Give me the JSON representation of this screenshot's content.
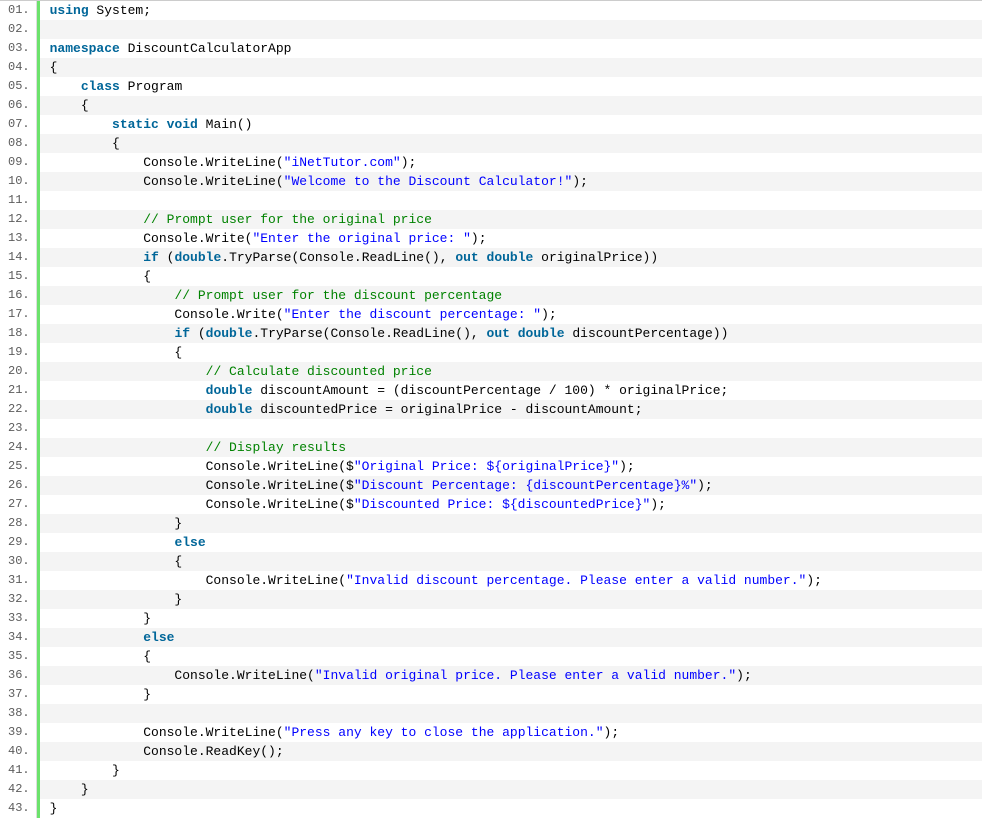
{
  "code": {
    "lines": [
      {
        "n": "01.",
        "tokens": [
          {
            "t": "kw",
            "v": "using"
          },
          {
            "t": "plain",
            "v": " System;"
          }
        ]
      },
      {
        "n": "02.",
        "tokens": []
      },
      {
        "n": "03.",
        "tokens": [
          {
            "t": "kw",
            "v": "namespace"
          },
          {
            "t": "plain",
            "v": " DiscountCalculatorApp"
          }
        ]
      },
      {
        "n": "04.",
        "tokens": [
          {
            "t": "plain",
            "v": "{"
          }
        ]
      },
      {
        "n": "05.",
        "tokens": [
          {
            "t": "plain",
            "v": "    "
          },
          {
            "t": "kw",
            "v": "class"
          },
          {
            "t": "plain",
            "v": " Program"
          }
        ]
      },
      {
        "n": "06.",
        "tokens": [
          {
            "t": "plain",
            "v": "    {"
          }
        ]
      },
      {
        "n": "07.",
        "tokens": [
          {
            "t": "plain",
            "v": "        "
          },
          {
            "t": "kw",
            "v": "static"
          },
          {
            "t": "plain",
            "v": " "
          },
          {
            "t": "kw",
            "v": "void"
          },
          {
            "t": "plain",
            "v": " Main()"
          }
        ]
      },
      {
        "n": "08.",
        "tokens": [
          {
            "t": "plain",
            "v": "        {"
          }
        ]
      },
      {
        "n": "09.",
        "tokens": [
          {
            "t": "plain",
            "v": "            Console.WriteLine("
          },
          {
            "t": "str",
            "v": "\"iNetTutor.com\""
          },
          {
            "t": "plain",
            "v": ");"
          }
        ]
      },
      {
        "n": "10.",
        "tokens": [
          {
            "t": "plain",
            "v": "            Console.WriteLine("
          },
          {
            "t": "str",
            "v": "\"Welcome to the Discount Calculator!\""
          },
          {
            "t": "plain",
            "v": ");"
          }
        ]
      },
      {
        "n": "11.",
        "tokens": []
      },
      {
        "n": "12.",
        "tokens": [
          {
            "t": "plain",
            "v": "            "
          },
          {
            "t": "cmt",
            "v": "// Prompt user for the original price"
          }
        ]
      },
      {
        "n": "13.",
        "tokens": [
          {
            "t": "plain",
            "v": "            Console.Write("
          },
          {
            "t": "str",
            "v": "\"Enter the original price: \""
          },
          {
            "t": "plain",
            "v": ");"
          }
        ]
      },
      {
        "n": "14.",
        "tokens": [
          {
            "t": "plain",
            "v": "            "
          },
          {
            "t": "kw",
            "v": "if"
          },
          {
            "t": "plain",
            "v": " ("
          },
          {
            "t": "kw",
            "v": "double"
          },
          {
            "t": "plain",
            "v": ".TryParse(Console.ReadLine(), "
          },
          {
            "t": "kw",
            "v": "out"
          },
          {
            "t": "plain",
            "v": " "
          },
          {
            "t": "kw",
            "v": "double"
          },
          {
            "t": "plain",
            "v": " originalPrice))"
          }
        ]
      },
      {
        "n": "15.",
        "tokens": [
          {
            "t": "plain",
            "v": "            {"
          }
        ]
      },
      {
        "n": "16.",
        "tokens": [
          {
            "t": "plain",
            "v": "                "
          },
          {
            "t": "cmt",
            "v": "// Prompt user for the discount percentage"
          }
        ]
      },
      {
        "n": "17.",
        "tokens": [
          {
            "t": "plain",
            "v": "                Console.Write("
          },
          {
            "t": "str",
            "v": "\"Enter the discount percentage: \""
          },
          {
            "t": "plain",
            "v": ");"
          }
        ]
      },
      {
        "n": "18.",
        "tokens": [
          {
            "t": "plain",
            "v": "                "
          },
          {
            "t": "kw",
            "v": "if"
          },
          {
            "t": "plain",
            "v": " ("
          },
          {
            "t": "kw",
            "v": "double"
          },
          {
            "t": "plain",
            "v": ".TryParse(Console.ReadLine(), "
          },
          {
            "t": "kw",
            "v": "out"
          },
          {
            "t": "plain",
            "v": " "
          },
          {
            "t": "kw",
            "v": "double"
          },
          {
            "t": "plain",
            "v": " discountPercentage))"
          }
        ]
      },
      {
        "n": "19.",
        "tokens": [
          {
            "t": "plain",
            "v": "                {"
          }
        ]
      },
      {
        "n": "20.",
        "tokens": [
          {
            "t": "plain",
            "v": "                    "
          },
          {
            "t": "cmt",
            "v": "// Calculate discounted price"
          }
        ]
      },
      {
        "n": "21.",
        "tokens": [
          {
            "t": "plain",
            "v": "                    "
          },
          {
            "t": "kw",
            "v": "double"
          },
          {
            "t": "plain",
            "v": " discountAmount = (discountPercentage / 100) * originalPrice;"
          }
        ]
      },
      {
        "n": "22.",
        "tokens": [
          {
            "t": "plain",
            "v": "                    "
          },
          {
            "t": "kw",
            "v": "double"
          },
          {
            "t": "plain",
            "v": " discountedPrice = originalPrice - discountAmount;"
          }
        ]
      },
      {
        "n": "23.",
        "tokens": []
      },
      {
        "n": "24.",
        "tokens": [
          {
            "t": "plain",
            "v": "                    "
          },
          {
            "t": "cmt",
            "v": "// Display results"
          }
        ]
      },
      {
        "n": "25.",
        "tokens": [
          {
            "t": "plain",
            "v": "                    Console.WriteLine($"
          },
          {
            "t": "str",
            "v": "\"Original Price: ${originalPrice}\""
          },
          {
            "t": "plain",
            "v": ");"
          }
        ]
      },
      {
        "n": "26.",
        "tokens": [
          {
            "t": "plain",
            "v": "                    Console.WriteLine($"
          },
          {
            "t": "str",
            "v": "\"Discount Percentage: {discountPercentage}%\""
          },
          {
            "t": "plain",
            "v": ");"
          }
        ]
      },
      {
        "n": "27.",
        "tokens": [
          {
            "t": "plain",
            "v": "                    Console.WriteLine($"
          },
          {
            "t": "str",
            "v": "\"Discounted Price: ${discountedPrice}\""
          },
          {
            "t": "plain",
            "v": ");"
          }
        ]
      },
      {
        "n": "28.",
        "tokens": [
          {
            "t": "plain",
            "v": "                }"
          }
        ]
      },
      {
        "n": "29.",
        "tokens": [
          {
            "t": "plain",
            "v": "                "
          },
          {
            "t": "kw",
            "v": "else"
          }
        ]
      },
      {
        "n": "30.",
        "tokens": [
          {
            "t": "plain",
            "v": "                {"
          }
        ]
      },
      {
        "n": "31.",
        "tokens": [
          {
            "t": "plain",
            "v": "                    Console.WriteLine("
          },
          {
            "t": "str",
            "v": "\"Invalid discount percentage. Please enter a valid number.\""
          },
          {
            "t": "plain",
            "v": ");"
          }
        ]
      },
      {
        "n": "32.",
        "tokens": [
          {
            "t": "plain",
            "v": "                }"
          }
        ]
      },
      {
        "n": "33.",
        "tokens": [
          {
            "t": "plain",
            "v": "            }"
          }
        ]
      },
      {
        "n": "34.",
        "tokens": [
          {
            "t": "plain",
            "v": "            "
          },
          {
            "t": "kw",
            "v": "else"
          }
        ]
      },
      {
        "n": "35.",
        "tokens": [
          {
            "t": "plain",
            "v": "            {"
          }
        ]
      },
      {
        "n": "36.",
        "tokens": [
          {
            "t": "plain",
            "v": "                Console.WriteLine("
          },
          {
            "t": "str",
            "v": "\"Invalid original price. Please enter a valid number.\""
          },
          {
            "t": "plain",
            "v": ");"
          }
        ]
      },
      {
        "n": "37.",
        "tokens": [
          {
            "t": "plain",
            "v": "            }"
          }
        ]
      },
      {
        "n": "38.",
        "tokens": []
      },
      {
        "n": "39.",
        "tokens": [
          {
            "t": "plain",
            "v": "            Console.WriteLine("
          },
          {
            "t": "str",
            "v": "\"Press any key to close the application.\""
          },
          {
            "t": "plain",
            "v": ");"
          }
        ]
      },
      {
        "n": "40.",
        "tokens": [
          {
            "t": "plain",
            "v": "            Console.ReadKey();"
          }
        ]
      },
      {
        "n": "41.",
        "tokens": [
          {
            "t": "plain",
            "v": "        }"
          }
        ]
      },
      {
        "n": "42.",
        "tokens": [
          {
            "t": "plain",
            "v": "    }"
          }
        ]
      },
      {
        "n": "43.",
        "tokens": [
          {
            "t": "plain",
            "v": "}"
          }
        ]
      }
    ]
  }
}
